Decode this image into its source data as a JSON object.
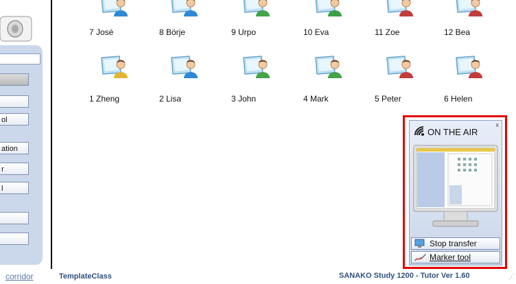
{
  "sidebar": {
    "buttons": [
      {
        "label": "",
        "style": "grey"
      },
      {
        "label": "",
        "style": "white"
      },
      {
        "label": "ol",
        "style": "white"
      },
      {
        "label": "ation",
        "style": "white"
      },
      {
        "label": "r",
        "style": "white"
      },
      {
        "label": "l",
        "style": "white"
      },
      {
        "label": "",
        "style": "white"
      },
      {
        "label": "",
        "style": "white"
      }
    ],
    "corridor_label": "corridor"
  },
  "students": [
    {
      "name": "7 José",
      "shirt": "#2f8ad6"
    },
    {
      "name": "8 Börje",
      "shirt": "#2f8ad6"
    },
    {
      "name": "9 Urpo",
      "shirt": "#45a34a"
    },
    {
      "name": "10 Eva",
      "shirt": "#3b9c4a"
    },
    {
      "name": "11 Zoe",
      "shirt": "#c23c3c"
    },
    {
      "name": "12 Bea",
      "shirt": "#c23c3c"
    },
    {
      "name": "1 Zheng",
      "shirt": "#e0b531"
    },
    {
      "name": "2 Lisa",
      "shirt": "#2f8ad6"
    },
    {
      "name": "3 John",
      "shirt": "#45a34a"
    },
    {
      "name": "4 Mark",
      "shirt": "#45a34a"
    },
    {
      "name": "5 Peter",
      "shirt": "#c23c3c"
    },
    {
      "name": "6 Helen",
      "shirt": "#c23c3c"
    }
  ],
  "on_air": {
    "title": "ON THE AIR",
    "close": "x",
    "stop_label": "Stop transfer",
    "marker_label": "Marker tool"
  },
  "status": {
    "class_name": "TemplateClass",
    "version": "SANAKO Study 1200 - Tutor   Ver 1.60"
  },
  "colors": {
    "highlight": "#e00000",
    "status_text": "#31507e",
    "panel": "#cbd7ea"
  }
}
